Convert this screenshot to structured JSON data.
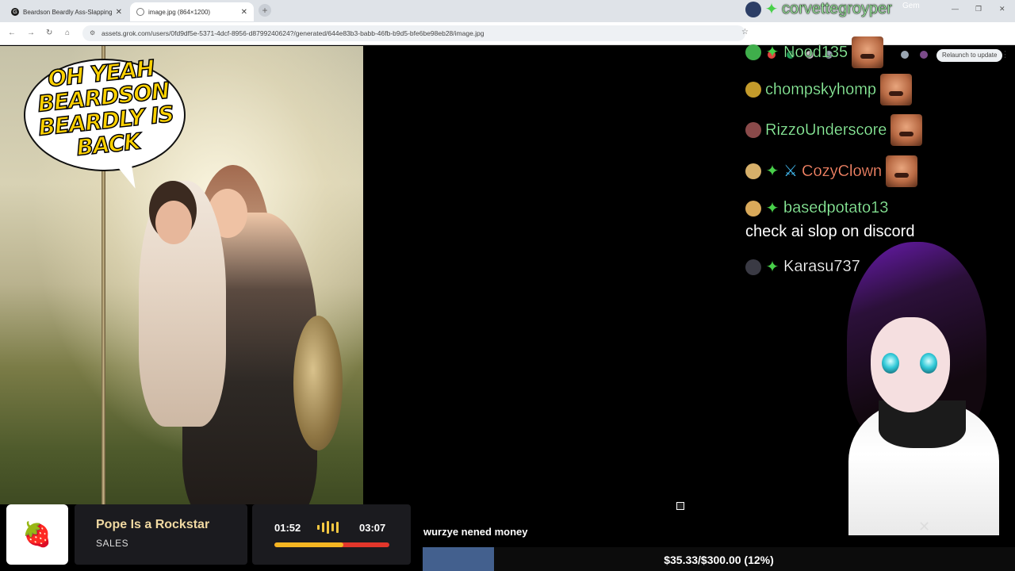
{
  "browser": {
    "tabs": [
      {
        "title": "Beardson Beardly Ass-Slapping",
        "active": false
      },
      {
        "title": "image.jpg (864×1200)",
        "active": true
      }
    ],
    "url": "assets.grok.com/users/0fd9df5e-5371-4dcf-8956-d8799240624?/generated/644e83b3-babb-46fb-b9d5-bfe6be98eb28/image.jpg",
    "relaunch_label": "Relaunch to update"
  },
  "image": {
    "speech_bubble": "OH YEAH BEARDSON BEARDLY IS BACK"
  },
  "chat": {
    "top_user": "corvettegroyper",
    "top_user_extra": "Gem",
    "messages": [
      {
        "user": "Nood135",
        "badge": true,
        "emote": true,
        "color": "#8ff59f"
      },
      {
        "user": "chompskyhomp",
        "badge": false,
        "emote": true,
        "color": "#8ff59f"
      },
      {
        "user": "RizzoUnderscore",
        "badge": false,
        "emote": true,
        "color": "#8ff59f"
      },
      {
        "user": "CozyClown",
        "badge": true,
        "emote": true,
        "color": "#ff8a6a"
      },
      {
        "user": "basedpotato13",
        "badge": true,
        "emote": false,
        "color": "#8ff59f",
        "text": "check ai slop on discord"
      },
      {
        "user": "Karasu737",
        "badge": true,
        "emote": false,
        "color": "#ffffff"
      }
    ]
  },
  "now_playing": {
    "title": "Pope Is a Rockstar",
    "artist": "SALES",
    "elapsed": "01:52",
    "total": "03:07",
    "progress": 0.6
  },
  "donation": {
    "message": "wurzye nened money",
    "goal_text": "$35.33/$300.00 (12%)",
    "goal_progress": 0.12
  },
  "colors": {
    "goal_fill": "#43608e",
    "progress_fill": "#f5b622",
    "progress_track": "#e2362b"
  }
}
